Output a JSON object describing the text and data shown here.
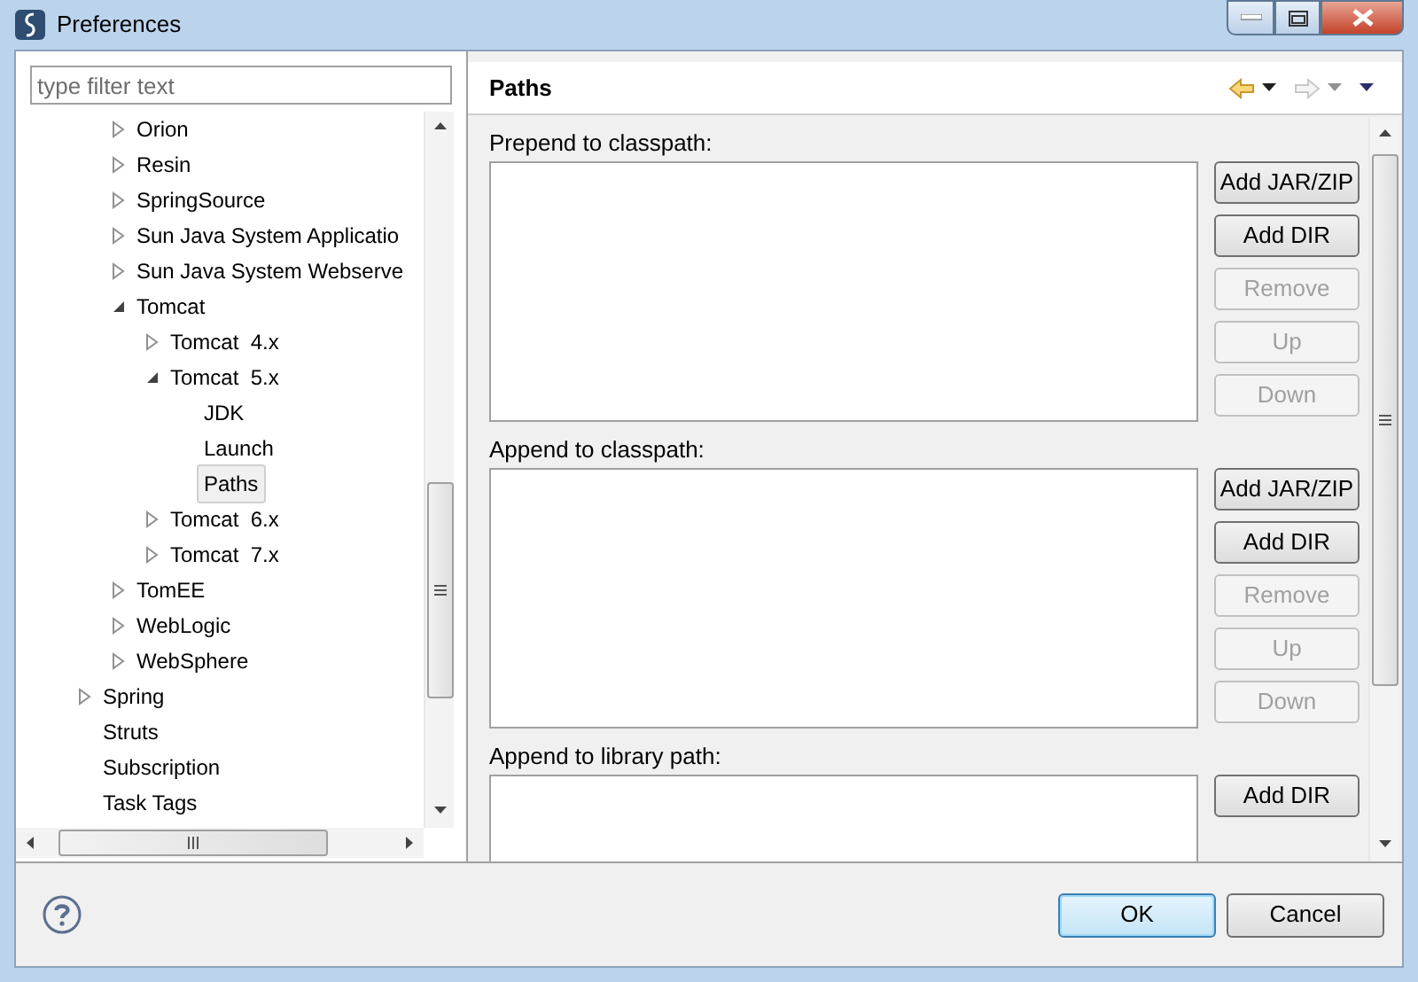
{
  "window": {
    "title": "Preferences"
  },
  "filter": {
    "placeholder": "type filter text"
  },
  "tree": [
    {
      "children": [
        {
          "label": "Orion",
          "expanded": false,
          "selected": false
        },
        {
          "label": "Resin",
          "expanded": false,
          "selected": false
        },
        {
          "label": "SpringSource",
          "expanded": false,
          "selected": false
        },
        {
          "label": "Sun Java System Applicatio",
          "expanded": false,
          "selected": false
        },
        {
          "label": "Sun Java System Webserve",
          "expanded": false,
          "selected": false
        },
        {
          "label": "Tomcat",
          "expanded": true,
          "selected": false,
          "children": [
            {
              "label": "Tomcat  4.x",
              "expanded": false,
              "selected": false
            },
            {
              "label": "Tomcat  5.x",
              "expanded": true,
              "selected": false,
              "children": [
                {
                  "label": "JDK",
                  "selected": false
                },
                {
                  "label": "Launch",
                  "selected": false
                },
                {
                  "label": "Paths",
                  "selected": true
                }
              ]
            },
            {
              "label": "Tomcat  6.x",
              "expanded": false,
              "selected": false
            },
            {
              "label": "Tomcat  7.x",
              "expanded": false,
              "selected": false
            }
          ]
        },
        {
          "label": "TomEE",
          "expanded": false,
          "selected": false
        },
        {
          "label": "WebLogic",
          "expanded": false,
          "selected": false
        },
        {
          "label": "WebSphere",
          "expanded": false,
          "selected": false
        }
      ]
    },
    {
      "label": "Spring",
      "expanded": false,
      "selected": false
    },
    {
      "label": "Struts",
      "selected": false
    },
    {
      "label": "Subscription",
      "selected": false
    },
    {
      "label": "Task Tags",
      "selected": false
    }
  ],
  "page": {
    "title": "Paths",
    "back_enabled": true,
    "forward_enabled": false,
    "sections": [
      {
        "label": "Prepend to classpath:",
        "buttons": [
          {
            "label": "Add JAR/ZIP",
            "disabled": false
          },
          {
            "label": "Add DIR",
            "disabled": false
          },
          {
            "label": "Remove",
            "disabled": true
          },
          {
            "label": "Up",
            "disabled": true
          },
          {
            "label": "Down",
            "disabled": true
          }
        ]
      },
      {
        "label": "Append to classpath:",
        "buttons": [
          {
            "label": "Add JAR/ZIP",
            "disabled": false
          },
          {
            "label": "Add DIR",
            "disabled": false
          },
          {
            "label": "Remove",
            "disabled": true
          },
          {
            "label": "Up",
            "disabled": true
          },
          {
            "label": "Down",
            "disabled": true
          }
        ]
      },
      {
        "label": "Append to library path:",
        "buttons": [
          {
            "label": "Add DIR",
            "disabled": false
          }
        ]
      }
    ]
  },
  "footer": {
    "buttons": [
      {
        "label": "OK",
        "default": true
      },
      {
        "label": "Cancel",
        "default": false
      }
    ]
  }
}
